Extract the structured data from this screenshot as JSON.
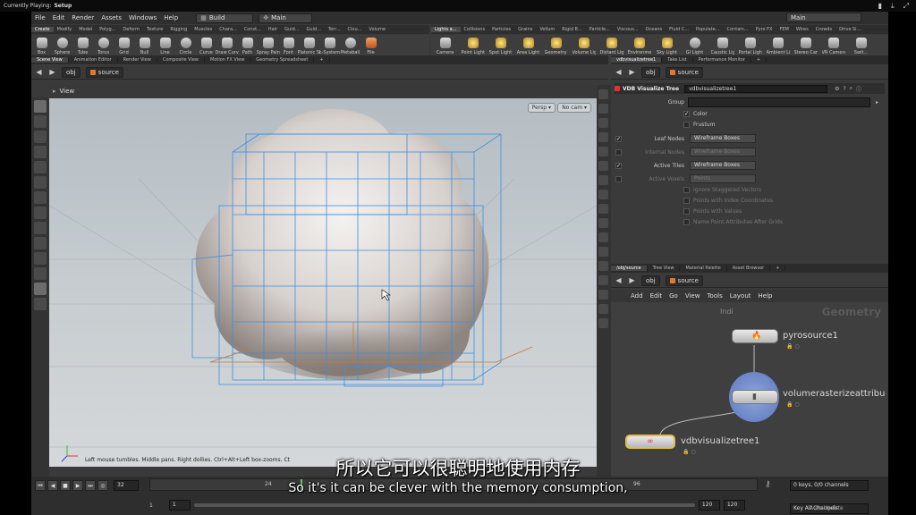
{
  "top_strip": {
    "now_playing_label": "Currently Playing:",
    "now_playing": "Setup"
  },
  "menubar": {
    "items": [
      "File",
      "Edit",
      "Render",
      "Assets",
      "Windows",
      "Help"
    ],
    "desktop": "Build",
    "context": "Main",
    "right_desktop": "Main"
  },
  "shelf_left": {
    "tabs": [
      "Create",
      "Modify",
      "Model",
      "Polyg...",
      "Deform",
      "Texture",
      "Rigging",
      "Muscles",
      "Chara...",
      "Const...",
      "Hair",
      "Guid...",
      "Guid...",
      "Terr...",
      "Clou...",
      "Volume"
    ],
    "tools": [
      "Box",
      "Sphere",
      "Tube",
      "Torus",
      "Grid",
      "Null",
      "Line",
      "Circle",
      "Curve",
      "Draw Curve",
      "Path",
      "Spray Paint",
      "Font",
      "Platonic Solids",
      "L-System",
      "Metaball",
      "File"
    ]
  },
  "shelf_right": {
    "tabs": [
      "Lights a...",
      "Collisions",
      "Particles",
      "Grains",
      "Vellum",
      "Rigid B...",
      "Particle...",
      "Viscous...",
      "Oceans",
      "Fluid C...",
      "Populate...",
      "Contain...",
      "Pyro FX",
      "FEM",
      "Wires",
      "Crowds",
      "Drive Si..."
    ],
    "tools": [
      "Camera",
      "Point Light",
      "Spot Light",
      "Area Light",
      "Geometry Light",
      "Volume Light",
      "Distant Light",
      "Environment Light",
      "Sky Light",
      "GI Light",
      "Caustic Light",
      "Portal Light",
      "Ambient Light",
      "Stereo Camera",
      "VR Camera",
      "Swit..."
    ]
  },
  "viewer_tabs": [
    "Scene View",
    "Animation Editor",
    "Render View",
    "Composite View",
    "Motion FX View",
    "Geometry Spreadsheet"
  ],
  "viewer_path": {
    "root": "obj",
    "node": "source"
  },
  "viewport": {
    "header_label": "View",
    "persp": "Persp",
    "camera": "No cam",
    "status_text": "Left mouse tumbles. Middle pans. Right dollies. Ctrl+Alt+Left box-zooms. Ct"
  },
  "param_tabs": [
    "vdbvisualizetree1",
    "Take List",
    "Performance Monitor"
  ],
  "param_path": {
    "root": "obj",
    "node": "source"
  },
  "params": {
    "node_type": "VDB Visualize Tree",
    "node_name": "vdbvisualizetree1",
    "group_label": "Group",
    "group_value": "",
    "color_label": "Color",
    "frustum_label": "Frustum",
    "leaf_nodes_label": "Leaf Nodes",
    "leaf_nodes_value": "Wireframe Boxes",
    "internal_nodes_label": "Internal Nodes",
    "internal_nodes_value": "Wireframe Boxes",
    "active_tiles_label": "Active Tiles",
    "active_tiles_value": "Wireframe Boxes",
    "active_voxels_label": "Active Voxels",
    "active_voxels_value": "Points",
    "ignore_staggered": "Ignore Staggered Vectors",
    "points_index": "Points with Index Coordinates",
    "points_values": "Points with Values",
    "name_point_attrs": "Name Point Attributes After Grids"
  },
  "network_tabs": [
    "/obj/source",
    "Tree View",
    "Material Palette",
    "Asset Browser"
  ],
  "network_path": {
    "root": "obj",
    "node": "source"
  },
  "network_menu": [
    "Add",
    "Edit",
    "Go",
    "View",
    "Tools",
    "Layout",
    "Help"
  ],
  "network": {
    "context_label": "Geometry",
    "partial_label": "Indi",
    "nodes": [
      {
        "name": "pyrosource1"
      },
      {
        "name": "volumerasterizeattribu"
      },
      {
        "name": "vdbvisualizetree1"
      }
    ]
  },
  "timeline": {
    "current_frame": "32",
    "start_frame": "1",
    "start_frame2": "1",
    "end_frame": "120",
    "end_frame2": "120",
    "ruler_ticks": [
      "24",
      "96"
    ],
    "keys_info": "0 keys, 0/0 channels",
    "channels_mode": "Key All Channels",
    "auto_update": "Auto Update"
  },
  "subtitles": {
    "cn": "所以它可以很聪明地使用内存",
    "en": "So it's it can be clever with the memory consumption,"
  },
  "colors": {
    "vdb_wire": "#3d8ee0",
    "bbox_orange": "#c47a3a",
    "node_highlight": "#e0c040"
  }
}
